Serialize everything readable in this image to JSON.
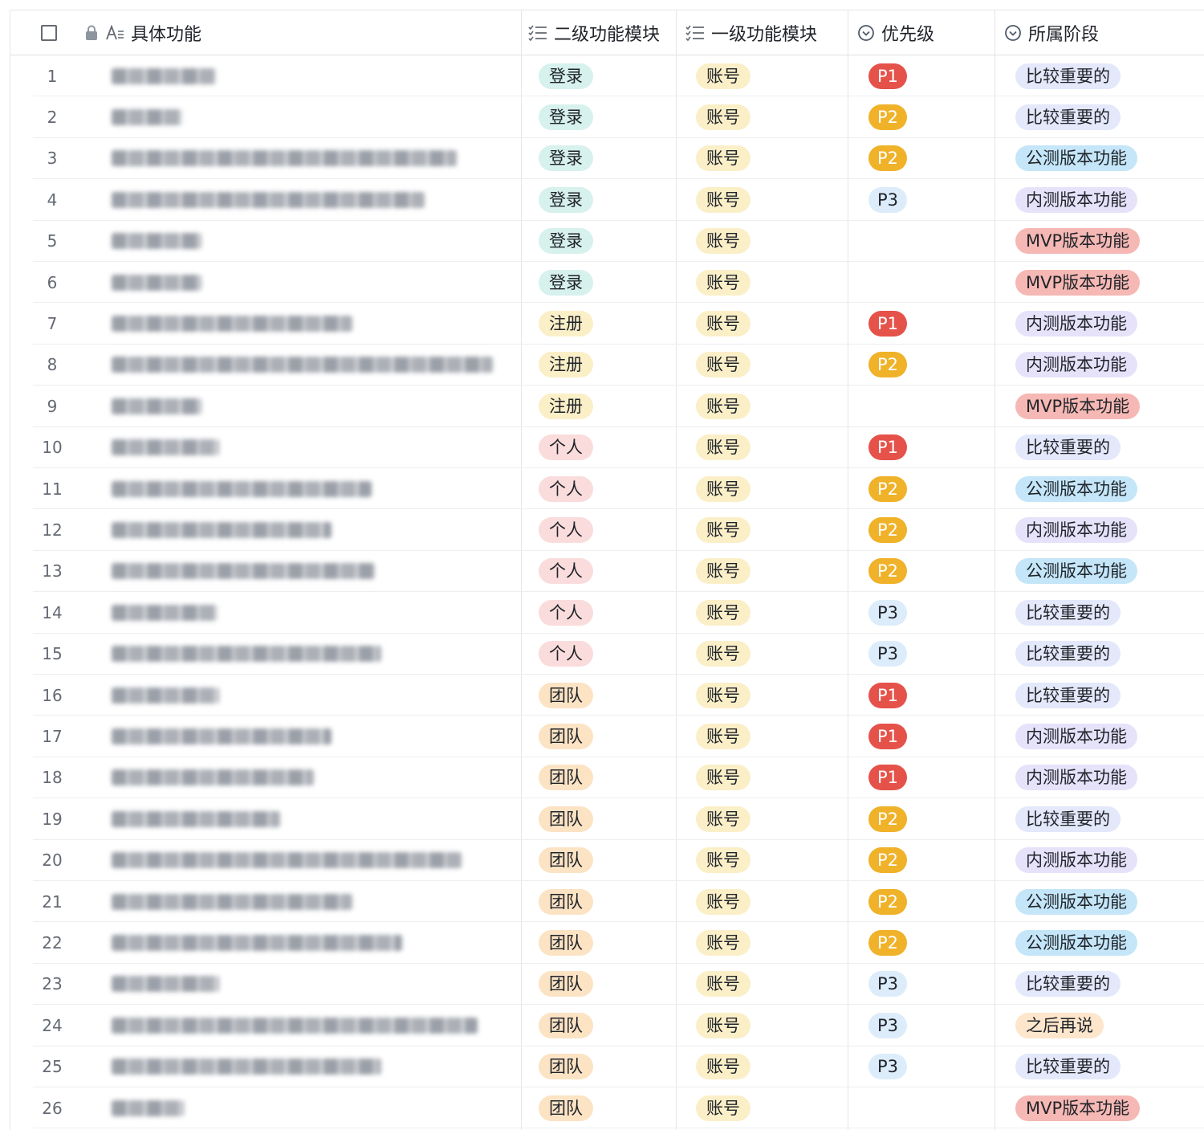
{
  "header": {
    "col_feature": "具体功能",
    "col_module2": "二级功能模块",
    "col_module1": "一级功能模块",
    "col_priority": "优先级",
    "col_stage": "所属阶段",
    "icons": {
      "checkbox": "checkbox-icon",
      "lock": "lock-icon",
      "text_field": "text-field-icon",
      "list": "list-icon",
      "single_select": "single-select-icon"
    }
  },
  "colors": {
    "p1": "#e5524a",
    "p2": "#efb229",
    "p3": "#dcecfa",
    "mvp": "#f5b8b4",
    "public": "#c4e6f8",
    "internal": "#e6e2fa",
    "important": "#e3e8fa",
    "later": "#fde6cc"
  },
  "rows": [
    {
      "num": "1",
      "module2": "登录",
      "m2": "login",
      "module1": "账号",
      "priority": "P1",
      "stage": "比较重要的",
      "st": "important",
      "blur_w": 130
    },
    {
      "num": "2",
      "module2": "登录",
      "m2": "login",
      "module1": "账号",
      "priority": "P2",
      "stage": "比较重要的",
      "st": "important",
      "blur_w": 88
    },
    {
      "num": "3",
      "module2": "登录",
      "m2": "login",
      "module1": "账号",
      "priority": "P2",
      "stage": "公测版本功能",
      "st": "public",
      "blur_w": 430
    },
    {
      "num": "4",
      "module2": "登录",
      "m2": "login",
      "module1": "账号",
      "priority": "P3",
      "stage": "内测版本功能",
      "st": "internal",
      "blur_w": 390
    },
    {
      "num": "5",
      "module2": "登录",
      "m2": "login",
      "module1": "账号",
      "priority": "",
      "stage": "MVP版本功能",
      "st": "mvp",
      "blur_w": 112
    },
    {
      "num": "6",
      "module2": "登录",
      "m2": "login",
      "module1": "账号",
      "priority": "",
      "stage": "MVP版本功能",
      "st": "mvp",
      "blur_w": 112
    },
    {
      "num": "7",
      "module2": "注册",
      "m2": "register",
      "module1": "账号",
      "priority": "P1",
      "stage": "内测版本功能",
      "st": "internal",
      "blur_w": 300
    },
    {
      "num": "8",
      "module2": "注册",
      "m2": "register",
      "module1": "账号",
      "priority": "P2",
      "stage": "内测版本功能",
      "st": "internal",
      "blur_w": 475
    },
    {
      "num": "9",
      "module2": "注册",
      "m2": "register",
      "module1": "账号",
      "priority": "",
      "stage": "MVP版本功能",
      "st": "mvp",
      "blur_w": 112
    },
    {
      "num": "10",
      "module2": "个人",
      "m2": "personal",
      "module1": "账号",
      "priority": "P1",
      "stage": "比较重要的",
      "st": "important",
      "blur_w": 134
    },
    {
      "num": "11",
      "module2": "个人",
      "m2": "personal",
      "module1": "账号",
      "priority": "P2",
      "stage": "公测版本功能",
      "st": "public",
      "blur_w": 324
    },
    {
      "num": "12",
      "module2": "个人",
      "m2": "personal",
      "module1": "账号",
      "priority": "P2",
      "stage": "内测版本功能",
      "st": "internal",
      "blur_w": 274
    },
    {
      "num": "13",
      "module2": "个人",
      "m2": "personal",
      "module1": "账号",
      "priority": "P2",
      "stage": "公测版本功能",
      "st": "public",
      "blur_w": 328
    },
    {
      "num": "14",
      "module2": "个人",
      "m2": "personal",
      "module1": "账号",
      "priority": "P3",
      "stage": "比较重要的",
      "st": "important",
      "blur_w": 132
    },
    {
      "num": "15",
      "module2": "个人",
      "m2": "personal",
      "module1": "账号",
      "priority": "P3",
      "stage": "比较重要的",
      "st": "important",
      "blur_w": 336
    },
    {
      "num": "16",
      "module2": "团队",
      "m2": "team",
      "module1": "账号",
      "priority": "P1",
      "stage": "比较重要的",
      "st": "important",
      "blur_w": 134
    },
    {
      "num": "17",
      "module2": "团队",
      "m2": "team",
      "module1": "账号",
      "priority": "P1",
      "stage": "内测版本功能",
      "st": "internal",
      "blur_w": 274
    },
    {
      "num": "18",
      "module2": "团队",
      "m2": "team",
      "module1": "账号",
      "priority": "P1",
      "stage": "内测版本功能",
      "st": "internal",
      "blur_w": 252
    },
    {
      "num": "19",
      "module2": "团队",
      "m2": "team",
      "module1": "账号",
      "priority": "P2",
      "stage": "比较重要的",
      "st": "important",
      "blur_w": 210
    },
    {
      "num": "20",
      "module2": "团队",
      "m2": "team",
      "module1": "账号",
      "priority": "P2",
      "stage": "内测版本功能",
      "st": "internal",
      "blur_w": 436
    },
    {
      "num": "21",
      "module2": "团队",
      "m2": "team",
      "module1": "账号",
      "priority": "P2",
      "stage": "公测版本功能",
      "st": "public",
      "blur_w": 300
    },
    {
      "num": "22",
      "module2": "团队",
      "m2": "team",
      "module1": "账号",
      "priority": "P2",
      "stage": "公测版本功能",
      "st": "public",
      "blur_w": 362
    },
    {
      "num": "23",
      "module2": "团队",
      "m2": "team",
      "module1": "账号",
      "priority": "P3",
      "stage": "比较重要的",
      "st": "important",
      "blur_w": 134
    },
    {
      "num": "24",
      "module2": "团队",
      "m2": "team",
      "module1": "账号",
      "priority": "P3",
      "stage": "之后再说",
      "st": "later",
      "blur_w": 456
    },
    {
      "num": "25",
      "module2": "团队",
      "m2": "team",
      "module1": "账号",
      "priority": "P3",
      "stage": "比较重要的",
      "st": "important",
      "blur_w": 336
    },
    {
      "num": "26",
      "module2": "团队",
      "m2": "team",
      "module1": "账号",
      "priority": "",
      "stage": "MVP版本功能",
      "st": "mvp",
      "blur_w": 90
    }
  ]
}
